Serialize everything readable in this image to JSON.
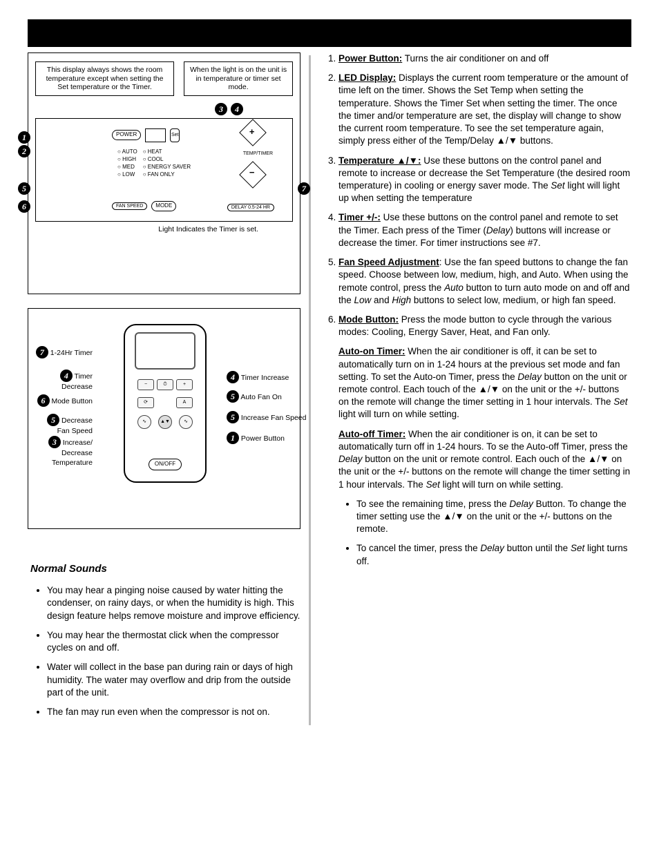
{
  "leftPanel": {
    "calloutA": "This display always shows the room temperature except when setting the Set temperature or the Timer.",
    "calloutB": "When the light is on the unit is in temperature or timer set mode.",
    "ctrl": {
      "power": "POWER",
      "fanSpeed": "FAN SPEED",
      "mode": "MODE",
      "delay": "DELAY 0.5-24 HR",
      "tempTimer": "TEMP/TIMER",
      "set": "Set",
      "leds": {
        "auto": "AUTO",
        "heat": "HEAT",
        "high": "HIGH",
        "cool": "COOL",
        "med": "MED",
        "esaver": "ENERGY SAVER",
        "low": "LOW",
        "fanonly": "FAN ONLY"
      }
    },
    "footerLabel": "Light Indicates the Timer is set."
  },
  "remote": {
    "labels": {
      "l7": "1-24Hr Timer",
      "l4": "Timer Decrease",
      "l6": "Mode Button",
      "l5": "Decrease Fan Speed",
      "l3": "Increase/ Decrease Temperature",
      "r4": "Timer Increase",
      "r5a": "Auto Fan On",
      "r5b": "Increase Fan Speed",
      "r1": "Power Button"
    },
    "onoff": "ON/OFF"
  },
  "normalSounds": {
    "heading": "Normal Sounds",
    "items": [
      "You may hear a pinging noise caused by water hitting the condenser, on rainy days, or when the humidity is high. This design feature helps remove moisture and improve efficiency.",
      "You may hear the thermostat click when the compressor cycles on and off.",
      "Water will collect in the base pan during rain or days of high humidity. The water may overflow and drip from the outside part of the unit.",
      "The fan may run even when the compressor is not on."
    ]
  },
  "descriptions": {
    "i1": {
      "key": "Power Button:",
      "text": " Turns the air conditioner on and off"
    },
    "i2": {
      "key": "LED Display:",
      "text": " Displays the current room temperature or the amount of time left on the timer. Shows the Set Temp when setting the temperature. Shows the Timer Set when setting the timer. The once the timer and/or temperature are set, the display will change to show the current room temperature. To see the set temperature again, simply press either of the Temp/Delay ▲/▼ buttons."
    },
    "i3": {
      "key": "Temperature ▲/▼:",
      "text1": " Use these buttons on the control panel and remote to increase or decrease the Set Temperature (the desired room temperature) in cooling or energy saver mode. The ",
      "setWord": "Set",
      "text2": " light will light up when setting the temperature"
    },
    "i4": {
      "key": "Timer +/-:",
      "text1": " Use these buttons on the control panel and remote to set the Timer. Each press of the Timer (",
      "delayWord": "Delay",
      "text2": ") buttons will increase or decrease the timer. For timer instructions see #7."
    },
    "i5": {
      "key": "Fan Speed Adjustment",
      "colon": ": Use the fan speed buttons to change the fan speed. Choose between low, medium, high, and Auto. When using the remote control, press the ",
      "w1": "Auto",
      "t2": " button to turn auto mode on and off and the ",
      "w2": "Low",
      "t3": " and ",
      "w3": "High",
      "t4": " buttons to select low, medium, or high fan speed."
    },
    "i6": {
      "key": "Mode Button:",
      "text": " Press the mode button to cycle through the various modes: Cooling, Energy Saver, Heat, and Fan only."
    },
    "autoOn": {
      "key": "Auto-on Timer:",
      "t1": " When the air conditioner is off, it can be set to automatically turn on in 1-24 hours at the previous set mode and fan setting. To set the Auto-on Timer, press the ",
      "w1": "Delay",
      "t2": " button on the unit or remote control. Each touch of the ▲/▼ on the unit or the +/- buttons on the remote will change the timer setting in 1 hour intervals. The ",
      "w2": "Set",
      "t3": " light will turn on while setting."
    },
    "autoOff": {
      "key": "Auto-off Timer:",
      "t1": " When the air conditioner is on, it can be set to automatically turn off in 1-24 hours. To se the Auto-off Timer, press the ",
      "w1": "Delay",
      "t2": " button on the unit or remote control. Each ouch of the ▲/▼ on the unit or the +/- buttons on the remote will change the timer setting in 1 hour intervals. The ",
      "w2": "Set",
      "t3": " light will turn on while setting."
    },
    "bullets": {
      "b1a": "To see the remaining time, press the ",
      "b1w": "Delay",
      "b1b": " Button. To change the timer setting use the ▲/▼ on the unit or the +/- buttons on the remote.",
      "b2a": "To cancel the timer, press the ",
      "b2w1": "Delay",
      "b2b": " button until the ",
      "b2w2": "Set",
      "b2c": " light turns off."
    }
  }
}
